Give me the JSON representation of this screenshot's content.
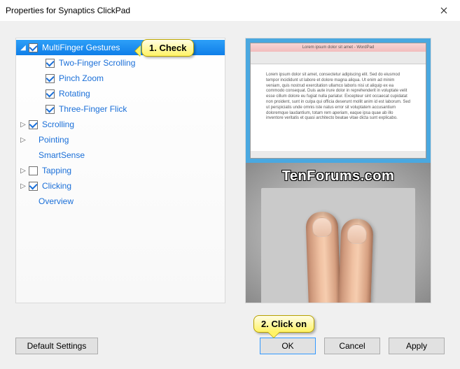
{
  "window": {
    "title": "Properties for Synaptics ClickPad"
  },
  "tree": {
    "multifinger": {
      "label": "MultiFinger Gestures",
      "checked": true
    },
    "twoFinger": {
      "label": "Two-Finger Scrolling",
      "checked": true
    },
    "pinchZoom": {
      "label": "Pinch Zoom",
      "checked": true
    },
    "rotating": {
      "label": "Rotating",
      "checked": true
    },
    "threeFlick": {
      "label": "Three-Finger Flick",
      "checked": true
    },
    "scrolling": {
      "label": "Scrolling",
      "checked": true
    },
    "pointing": {
      "label": "Pointing"
    },
    "smartsense": {
      "label": "SmartSense"
    },
    "tapping": {
      "label": "Tapping",
      "checked": false
    },
    "clicking": {
      "label": "Clicking",
      "checked": true
    },
    "overview": {
      "label": "Overview"
    }
  },
  "preview": {
    "doc_title": "Lorem ipsum dolor sit amet - WordPad",
    "watermark": "TenForums.com",
    "doc_body": "Lorem ipsum dolor sit amet, consectetur adipiscing elit. Sed do eiusmod tempor incididunt ut labore et dolore magna aliqua. Ut enim ad minim veniam, quis nostrud exercitation ullamco laboris nisi ut aliquip ex ea commodo consequat. Duis aute irure dolor in reprehenderit in voluptate velit esse cillum dolore eu fugiat nulla pariatur. Excepteur sint occaecat cupidatat non proident, sunt in culpa qui officia deserunt mollit anim id est laborum. Sed ut perspiciatis unde omnis iste natus error sit voluptatem accusantium doloremque laudantium, totam rem aperiam, eaque ipsa quae ab illo inventore veritatis et quasi architecto beatae vitae dicta sunt explicabo."
  },
  "buttons": {
    "defaults": "Default Settings",
    "ok": "OK",
    "cancel": "Cancel",
    "apply": "Apply"
  },
  "callouts": {
    "c1": "1. Check",
    "c2": "2. Click on"
  }
}
